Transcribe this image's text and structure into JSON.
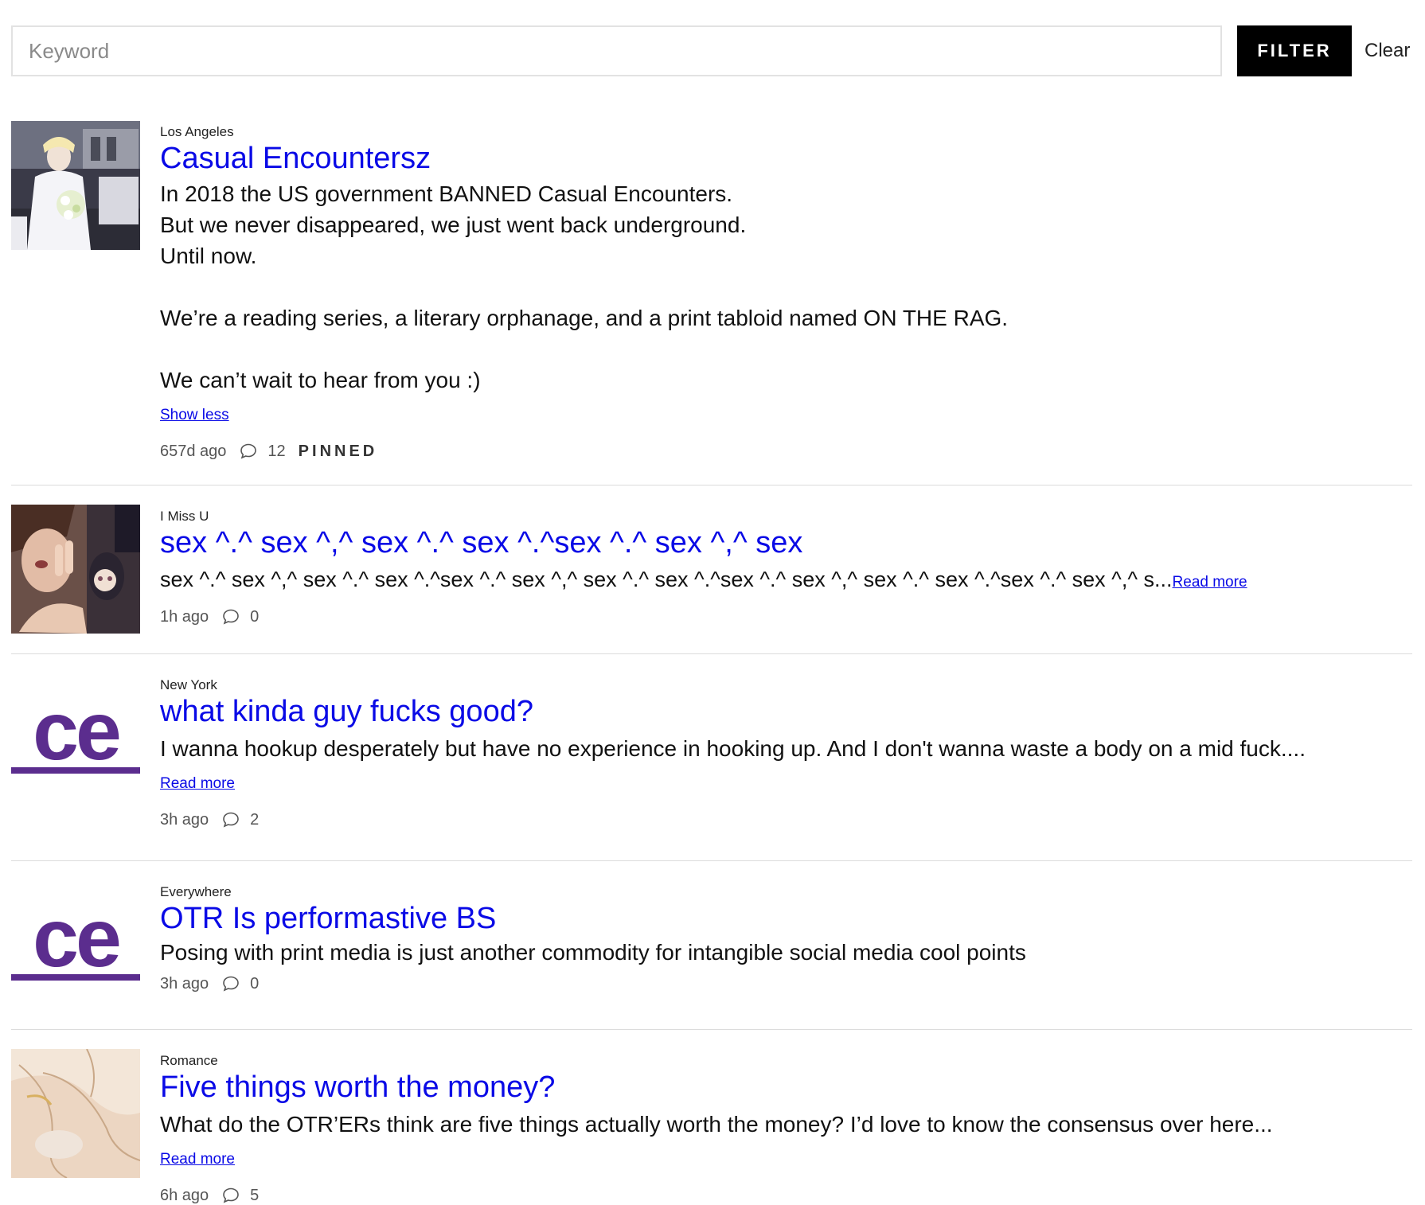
{
  "search": {
    "placeholder": "Keyword",
    "value": "",
    "filter_label": "FILTER",
    "clear_label": "Clear"
  },
  "posts": [
    {
      "location": "Los Angeles",
      "title": "Casual Encountersz",
      "body_lines": [
        "In 2018 the US government BANNED Casual Encounters.",
        "But we never disappeared, we just went back underground.",
        "Until now.",
        "We’re a reading series, a literary orphanage, and a print tabloid named ON THE RAG.",
        "We can’t wait to hear from you :)"
      ],
      "toggle_label": "Show less",
      "age": "657d ago",
      "comments": "12",
      "pinned_label": "PINNED",
      "thumb": "bride-photo"
    },
    {
      "location": "I Miss U",
      "title": "sex ^.^ sex ^,^ sex ^.^ sex ^.^sex ^.^ sex ^,^ sex",
      "body": "sex ^.^ sex ^,^ sex ^.^ sex ^.^sex ^.^ sex ^,^ sex ^.^ sex ^.^sex ^.^ sex ^,^ sex ^.^ sex ^.^sex ^.^ sex ^,^ s...",
      "more_label": "Read more",
      "age": "1h ago",
      "comments": "0",
      "thumb": "selfie-photo"
    },
    {
      "location": "New York",
      "title": "what kinda guy fucks good?",
      "body": "I wanna hookup desperately but have no experience in hooking up. And I don't wanna waste a body on a mid fuck....",
      "more_label": "Read more",
      "age": "3h ago",
      "comments": "2",
      "thumb": "ce-logo",
      "thumb_text": "ce"
    },
    {
      "location": "Everywhere",
      "title": "OTR Is performastive BS",
      "body": "Posing with print media is just another commodity for intangible social media cool points",
      "age": "3h ago",
      "comments": "0",
      "thumb": "ce-logo",
      "thumb_text": "ce"
    },
    {
      "location": "Romance",
      "title": "Five things worth the money?",
      "body": "What do the OTR’ERs think are five things actually worth the money? I’d love to know the consensus over here...",
      "more_label": "Read more",
      "age": "6h ago",
      "comments": "5",
      "thumb": "painting-photo"
    }
  ],
  "colors": {
    "link": "#0a0ae6",
    "logo_purple": "#5b2d8e",
    "button_bg": "#000000"
  }
}
